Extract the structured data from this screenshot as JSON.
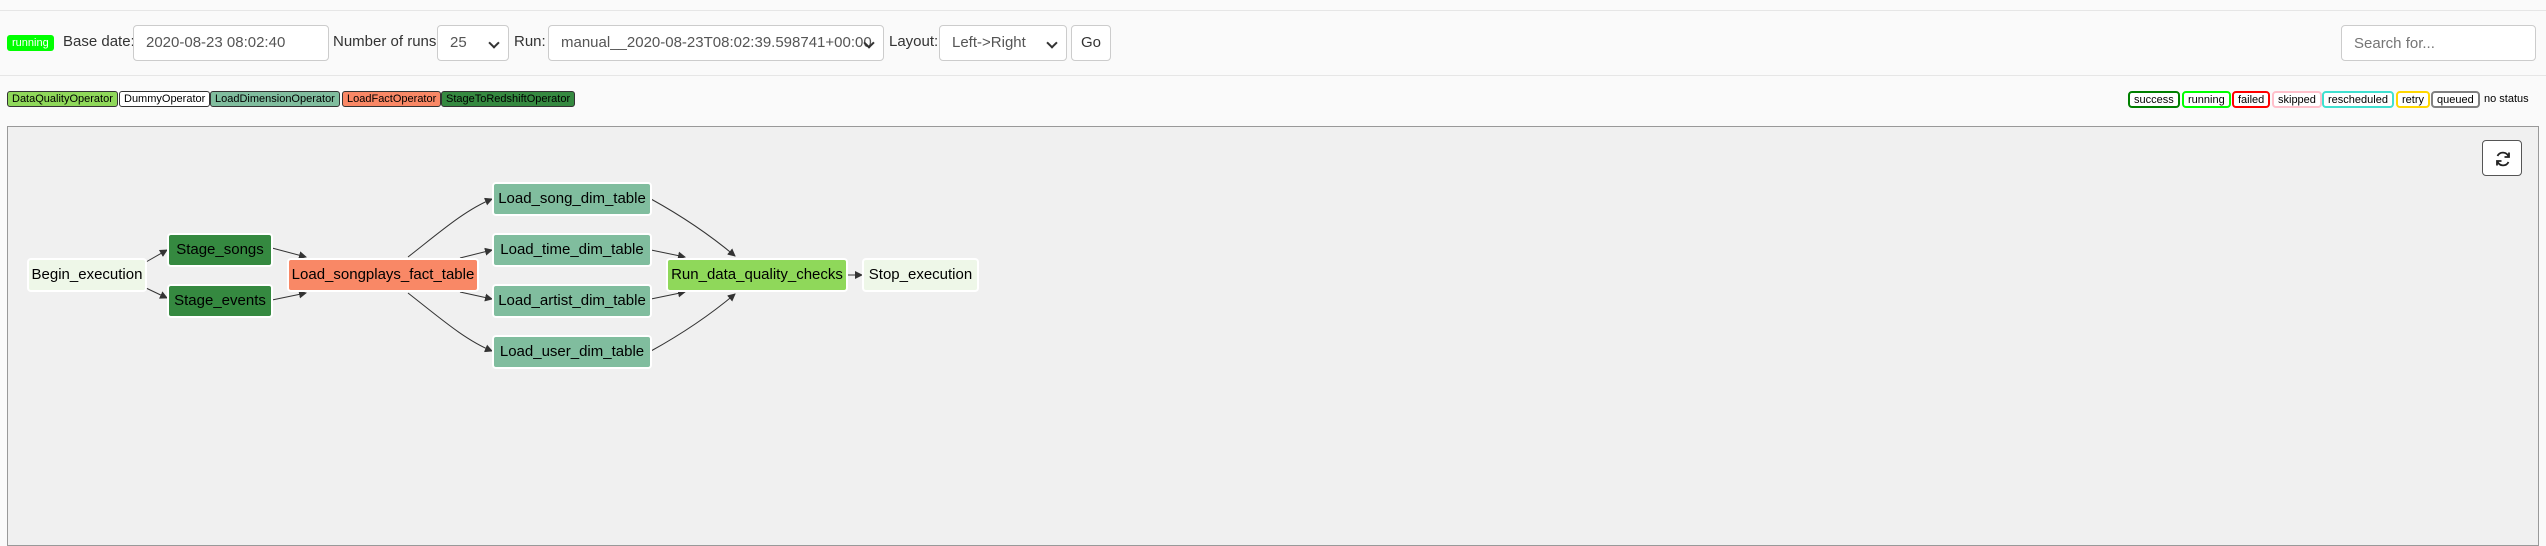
{
  "toolbar": {
    "state_badge": "running",
    "base_date_label": "Base date:",
    "base_date_value": "2020-08-23 08:02:40",
    "num_runs_label": "Number of runs:",
    "num_runs_value": "25",
    "run_label": "Run:",
    "run_value": "manual__2020-08-23T08:02:39.598741+00:00",
    "layout_label": "Layout:",
    "layout_value": "Left->Right",
    "go_label": "Go",
    "search_placeholder": "Search for..."
  },
  "operator_legend": [
    {
      "label": "DataQualityOperator",
      "color": "#8fd85a"
    },
    {
      "label": "DummyOperator",
      "color": "#ffffff"
    },
    {
      "label": "LoadDimensionOperator",
      "color": "#80bd9e"
    },
    {
      "label": "LoadFactOperator",
      "color": "#f98866"
    },
    {
      "label": "StageToRedshiftOperator",
      "color": "#358940"
    }
  ],
  "state_legend": [
    {
      "label": "success",
      "color": "#008000"
    },
    {
      "label": "running",
      "color": "#00ff00"
    },
    {
      "label": "failed",
      "color": "#ff0000"
    },
    {
      "label": "skipped",
      "color": "#ffc0cb"
    },
    {
      "label": "rescheduled",
      "color": "#40e0d0"
    },
    {
      "label": "retry",
      "color": "#ffd700"
    },
    {
      "label": "queued",
      "color": "#808080"
    }
  ],
  "no_status_label": "no status",
  "graph": {
    "nodes": {
      "begin": "Begin_execution",
      "stage_songs": "Stage_songs",
      "stage_events": "Stage_events",
      "load_fact": "Load_songplays_fact_table",
      "load_song_dim": "Load_song_dim_table",
      "load_time_dim": "Load_time_dim_table",
      "load_artist_dim": "Load_artist_dim_table",
      "load_user_dim": "Load_user_dim_table",
      "quality_checks": "Run_data_quality_checks",
      "stop": "Stop_execution"
    }
  }
}
